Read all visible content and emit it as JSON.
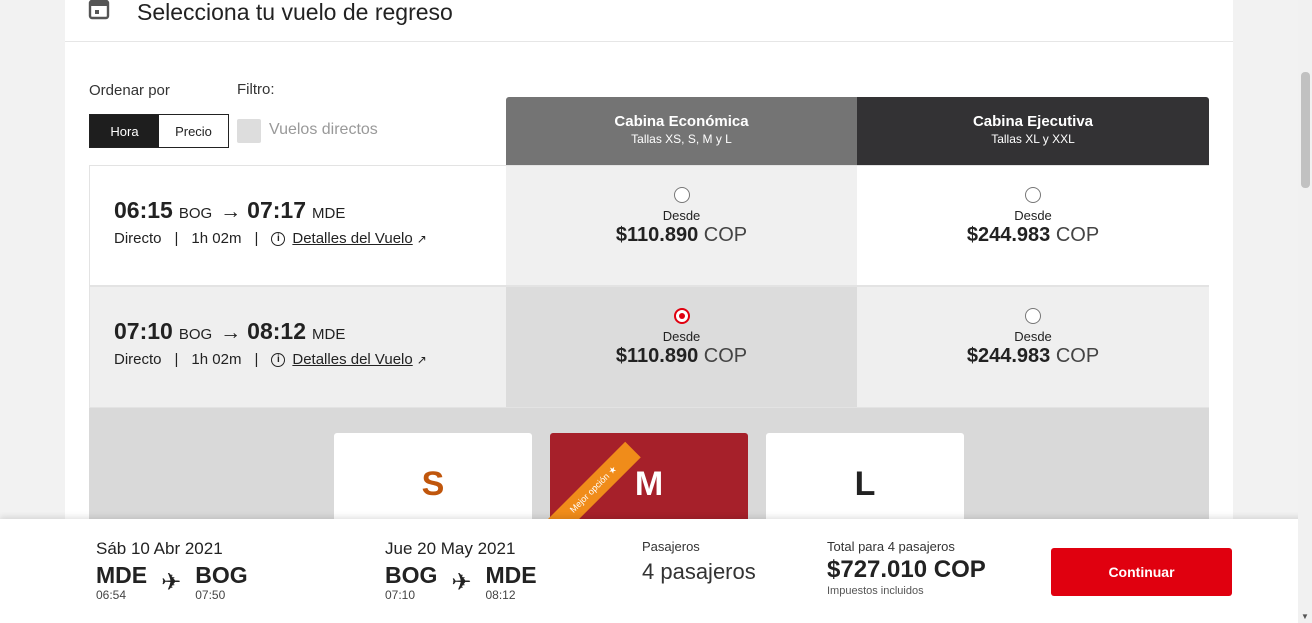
{
  "header": {
    "title": "Selecciona tu vuelo de regreso",
    "icon": "calendar-icon"
  },
  "controls": {
    "sort_label": "Ordenar por",
    "sort_options": [
      "Hora",
      "Precio"
    ],
    "sort_selected": "Hora",
    "filter_label": "Filtro:",
    "filter_direct_label": "Vuelos directos",
    "filter_direct_checked": false
  },
  "cabins": [
    {
      "name": "Cabina Económica",
      "sizes": "Tallas XS, S, M y L"
    },
    {
      "name": "Cabina Ejecutiva",
      "sizes": "Tallas XL y XXL"
    }
  ],
  "flights": [
    {
      "dep_time": "06:15",
      "dep_code": "BOG",
      "arr_time": "07:17",
      "arr_code": "MDE",
      "type": "Directo",
      "duration": "1h 02m",
      "details_label": "Detalles del Vuelo",
      "econ": {
        "from": "Desde",
        "amount": "$110.890",
        "currency": "COP",
        "selected": false
      },
      "exec": {
        "from": "Desde",
        "amount": "$244.983",
        "currency": "COP",
        "selected": false
      }
    },
    {
      "dep_time": "07:10",
      "dep_code": "BOG",
      "arr_time": "08:12",
      "arr_code": "MDE",
      "type": "Directo",
      "duration": "1h 02m",
      "details_label": "Detalles del Vuelo",
      "econ": {
        "from": "Desde",
        "amount": "$110.890",
        "currency": "COP",
        "selected": true
      },
      "exec": {
        "from": "Desde",
        "amount": "$244.983",
        "currency": "COP",
        "selected": false
      }
    }
  ],
  "size_options": [
    {
      "label": "S",
      "color": "#c0560c"
    },
    {
      "label": "M",
      "color": "#a6202a",
      "ribbon": "Mejor opción"
    },
    {
      "label": "L",
      "color": "#222222"
    }
  ],
  "footer": {
    "outbound": {
      "date": "Sáb 10 Abr 2021",
      "from_code": "MDE",
      "from_time": "06:54",
      "to_code": "BOG",
      "to_time": "07:50"
    },
    "return": {
      "date": "Jue 20 May 2021",
      "from_code": "BOG",
      "from_time": "07:10",
      "to_code": "MDE",
      "to_time": "08:12"
    },
    "passengers_label": "Pasajeros",
    "passengers_value": "4 pasajeros",
    "total_label": "Total para 4 pasajeros",
    "total_value": "$727.010 COP",
    "total_note": "Impuestos incluidos",
    "continue_label": "Continuar"
  },
  "colors": {
    "accent": "#e0000f",
    "econ_header": "#747474",
    "exec_header": "#333234",
    "best_option": "#f08c1a",
    "selected_size": "#a6202a"
  }
}
